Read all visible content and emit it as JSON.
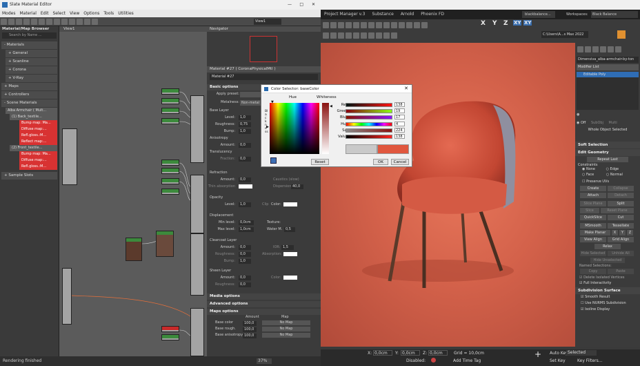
{
  "sme": {
    "title": "Slate Material Editor",
    "menu": [
      "Modes",
      "Material",
      "Edit",
      "Select",
      "View",
      "Options",
      "Tools",
      "Utilities"
    ],
    "view_dropdown": "View1",
    "view_tab": "View1",
    "navigator": "Navigator",
    "status": "Rendering finished",
    "zoom": "37%"
  },
  "browser": {
    "title": "Material/Map Browser",
    "search_placeholder": "Search by Name ...",
    "materials": "- Materials",
    "general": "+ General",
    "scanline": "+ Scanline",
    "corona": "+ Corona",
    "vray": "+ V-Ray",
    "maps": "+ Maps",
    "controllers": "+ Controllers",
    "scene_materials": "- Scene Materials",
    "items": [
      "Alba Armchair ( Mult...",
      "(1) Back_textile...",
      "Bump map: Ma...",
      "Diffuse map:...",
      "Refl.gloss.:M...",
      "Reflect map:...",
      "(2) Front_textile...",
      "Bump map: Ma...",
      "Diffuse map:...",
      "Refl.gloss.:M..."
    ],
    "sample_slots": "+ Sample Slots"
  },
  "params": {
    "title": "Material #27  ( CoronaPhysicalMtl )",
    "name": "Material #27",
    "basic_options": "Basic options",
    "apply_preset": "Apply preset:",
    "metalness": "Metalness:",
    "metalness_value": "Non-metal",
    "base_layer": "Base Layer",
    "level": "Level:",
    "level_v": "1,0",
    "roughness": "Roughness:",
    "roughness_v": "0,75",
    "bump": "Bump:",
    "bump_v": "1,0",
    "anisotropy": "Anisotropy",
    "amount": "Amount:",
    "aniso_v": "0,0",
    "translucency": "Translucency",
    "fraction": "Fraction:",
    "fraction_v": "0,0",
    "refraction": "Refraction",
    "refr_amount": "0,0",
    "caustics": "Caustics (slow)",
    "thin_absorption": "Thin absorption",
    "dispersion": "Dispersion",
    "dispersion_v": "40,0",
    "opacity": "Opacity",
    "op_level": "1,0",
    "clip": "Clip",
    "color": "Color:",
    "displacement": "Displacement",
    "min_level": "Min level:",
    "min_v": "0,0cm",
    "texture": "Texture:",
    "max_level": "Max level:",
    "max_v": "1,0cm",
    "water_m": "Water M.",
    "water_v": "0,5",
    "clearcoat": "Clearcoat Layer",
    "cc_amount": "0,0",
    "ior": "IOR:",
    "ior_v": "1,5",
    "cc_rough": "0,0",
    "absorption": "Absorption:",
    "cc_bump": "1,0",
    "sheen": "Sheen Layer",
    "sh_amount": "0,0",
    "sh_rough": "0,0",
    "media": "Media options",
    "advanced": "Advanced options",
    "maps_options": "Maps options",
    "col_amount": "Amount",
    "col_map": "Map",
    "map_rows": [
      {
        "label": "Base color",
        "amount": "100,0",
        "map": "No Map"
      },
      {
        "label": "Base rough.",
        "amount": "100,0",
        "map": "No Map"
      },
      {
        "label": "Base anisotropy",
        "amount": "100,0",
        "map": "No Map"
      }
    ]
  },
  "color_dialog": {
    "title": "Color Selector: baseColor",
    "hue": "Hue",
    "whiteness": "Whiteness",
    "blackness": "Blackness",
    "labels": [
      "Red:",
      "Green:",
      "Blue:",
      "Hue:",
      "Sat:",
      "Value:"
    ],
    "values": [
      "138",
      "19",
      "17",
      "4",
      "224",
      "138"
    ],
    "reset": "Reset",
    "ok": "OK",
    "cancel": "Cancel",
    "colors": {
      "red": "#8a1311",
      "hue_marker": "#e04a30"
    }
  },
  "max": {
    "menu": [
      "Project Manager v.3",
      "Substance",
      "Arnold",
      "Phoenix FD"
    ],
    "user": "blackbalance...",
    "workspaces": "Workspaces:",
    "workspace_value": "Black Balance Workspace",
    "path": "C:\\Users\\A...s Max 2022",
    "axes": [
      "X",
      "Y",
      "Z",
      "XY",
      "XY"
    ]
  },
  "cmd": {
    "object": "Dimensiva_alba-armchair-by-ton",
    "modifier_list": "Modifier List",
    "modifier": "Editable Poly",
    "off": "Off",
    "subobj": "SubObj",
    "multi": "Multi",
    "whole_selected": "Whole Object Selected",
    "soft_selection": "Soft Selection",
    "edit_geometry": "Edit Geometry",
    "repeat_last": "Repeat Last",
    "constraints": "Constraints",
    "none": "None",
    "edge": "Edge",
    "face": "Face",
    "normal": "Normal",
    "preserve_uvs": "Preserve UVs",
    "create": "Create",
    "collapse": "Collapse",
    "attach": "Attach",
    "detach": "Detach",
    "slice_plane": "Slice Plane",
    "split": "Split",
    "slice": "Slice",
    "reset_plane": "Reset Plane",
    "quickslice": "QuickSlice",
    "cut": "Cut",
    "msmooth": "MSmooth",
    "tessellate": "Tessellate",
    "make_planar": "Make Planar",
    "x": "X",
    "y": "Y",
    "z": "Z",
    "view_align": "View Align",
    "grid_align": "Grid Align",
    "relax": "Relax",
    "hide_selected": "Hide Selected",
    "unhide_all": "Unhide All",
    "hide_unselected": "Hide Unselected",
    "named_selections": "Named Selections:",
    "copy": "Copy",
    "paste": "Paste",
    "delete_isolated": "Delete Isolated Vertices",
    "full_interactivity": "Full Interactivity",
    "subdivision_surface": "Subdivision Surface",
    "smooth_result": "Smooth Result",
    "use_nurms": "Use NURMS Subdivision",
    "isoline": "Isoline Display"
  },
  "maxstatus": {
    "x": "X:",
    "xv": "0,0cm",
    "y": "Y:",
    "yv": "0,0cm",
    "z": "Z:",
    "zv": "0,0cm",
    "grid": "Grid = 10,0cm",
    "disabled": "Disabled:",
    "add_time_tag": "Add Time Tag",
    "auto_key": "Auto Key",
    "selected": "Selected",
    "set_key": "Set Key",
    "key_filters": "Key Filters..."
  }
}
